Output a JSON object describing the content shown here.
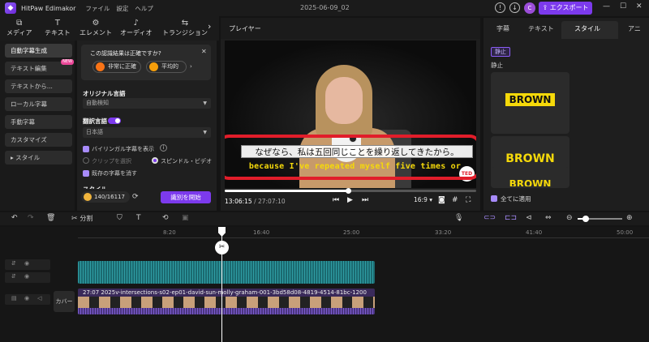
{
  "app": {
    "name": "HitPaw Edimakor",
    "menu": [
      "ファイル",
      "設定",
      "ヘルプ"
    ],
    "doc_title": "2025-06-09_02",
    "export_label": "エクスポート",
    "avatar_letter": "C"
  },
  "toolbar": {
    "items": [
      {
        "label": "メディア",
        "icon": "media-icon",
        "glyph": "⧉"
      },
      {
        "label": "テキスト",
        "icon": "text-icon",
        "glyph": "T"
      },
      {
        "label": "エレメント",
        "icon": "element-icon",
        "glyph": "⚙"
      },
      {
        "label": "オーディオ",
        "icon": "audio-icon",
        "glyph": "♪"
      },
      {
        "label": "トランジション",
        "icon": "transition-icon",
        "glyph": "⇆"
      }
    ]
  },
  "leftnav": {
    "items": [
      "自動字幕生成",
      "テキスト編集",
      "テキストから...",
      "ローカル字幕",
      "手動字幕",
      "カスタマイズ",
      "スタイル"
    ],
    "new_badge": "NEW"
  },
  "subpanel": {
    "question": "この認識結果は正確ですか?",
    "accurate": "非常に正確",
    "average": "平均的",
    "orig_lang_label": "オリジナル言語",
    "orig_lang_value": "自動検知",
    "trans_label": "翻訳言語",
    "trans_value": "日本語",
    "bilingual": "バイリンガル字幕を表示",
    "clip_select": "クリップを選択",
    "speed_video": "スピンドル・ビデオ",
    "delete_existing": "既存の字幕を消す",
    "style_label": "スタイル",
    "credits": "140/16117",
    "start_btn": "識別を開始"
  },
  "player": {
    "header": "プレイヤー",
    "subtitle_jp": "なぜなら、私は五回同じことを繰り返してきたから。",
    "subtitle_en": "because I've repeated myself five times or",
    "ted": "TED",
    "time_current": "13:06:15",
    "time_total": "/ 27:07:10",
    "ratio": "16:9",
    "progress": 0.49
  },
  "rightpanel": {
    "tabs": [
      "字幕",
      "テキスト",
      "スタイル",
      "アニ"
    ],
    "static_badge": "静止",
    "static_label": "静止",
    "style_sample": "BROWN",
    "apply_all": "全てに適用"
  },
  "timeline_tools": {
    "split": "分割"
  },
  "timeline": {
    "ticks": [
      "8:20",
      "16:40",
      "25:00",
      "33:20",
      "41:40",
      "50:00"
    ],
    "clip_title": "27:07 2025v-intersections-s02-ep01-david-sun-molly-graham-001-3bd58d08-4819-4514-81bc-1200",
    "cover_label": "カバー"
  },
  "colors": {
    "accent": "#7c3aed",
    "subtitle_en": "#f5d90a",
    "highlight_box": "#e11d2a",
    "audio_track": "#2f9ea5"
  }
}
